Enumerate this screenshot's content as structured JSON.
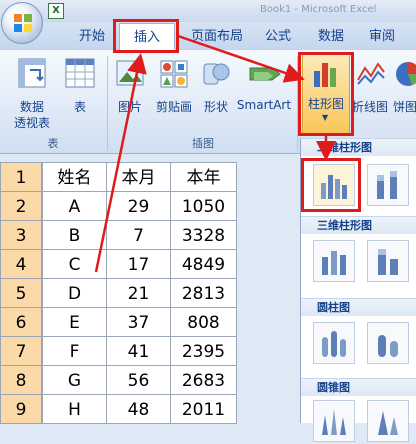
{
  "window": {
    "title": "Book1 - Microsoft Excel"
  },
  "qat": {
    "excel_icon": "X"
  },
  "tabs": {
    "home": "开始",
    "insert": "插入",
    "page_layout": "页面布局",
    "formulas": "公式",
    "data": "数据",
    "review": "审阅"
  },
  "ribbon": {
    "tables_group": {
      "title": "表",
      "pivot_label_1": "数据",
      "pivot_label_2": "透视表",
      "table_label": "表"
    },
    "illustrations_group": {
      "title": "插图",
      "picture_label": "图片",
      "clipart_label": "剪贴画",
      "shapes_label": "形状",
      "smartart_label": "SmartArt"
    },
    "charts_group": {
      "column_label": "柱形图",
      "line_label": "折线图",
      "pie_label": "饼图"
    }
  },
  "sheet": {
    "row_numbers": [
      "1",
      "2",
      "3",
      "4",
      "5",
      "6",
      "7",
      "8",
      "9"
    ],
    "headers": [
      "姓名",
      "本月",
      "本年"
    ],
    "rows": [
      [
        "A",
        "29",
        "1050"
      ],
      [
        "B",
        "7",
        "3328"
      ],
      [
        "C",
        "17",
        "4849"
      ],
      [
        "D",
        "21",
        "2813"
      ],
      [
        "E",
        "37",
        "808"
      ],
      [
        "F",
        "41",
        "2395"
      ],
      [
        "G",
        "56",
        "2683"
      ],
      [
        "H",
        "48",
        "2011"
      ]
    ]
  },
  "gallery": {
    "section_2d": "二维柱形图",
    "section_3d": "三维柱形图",
    "section_cylinder": "圆柱图",
    "section_cone": "圆锥图"
  },
  "colors": {
    "highlight": "#e01b1b",
    "row_header": "#fbd9a8",
    "ribbon": "#dce7f5",
    "tab_text": "#15428b"
  },
  "icons": [
    "office-logo-icon",
    "excel-icon",
    "pivot-table-icon",
    "table-icon",
    "picture-icon",
    "clipart-icon",
    "shapes-icon",
    "smartart-icon",
    "column-chart-icon",
    "line-chart-icon",
    "pie-chart-icon",
    "chart-thumbnail-icon"
  ]
}
